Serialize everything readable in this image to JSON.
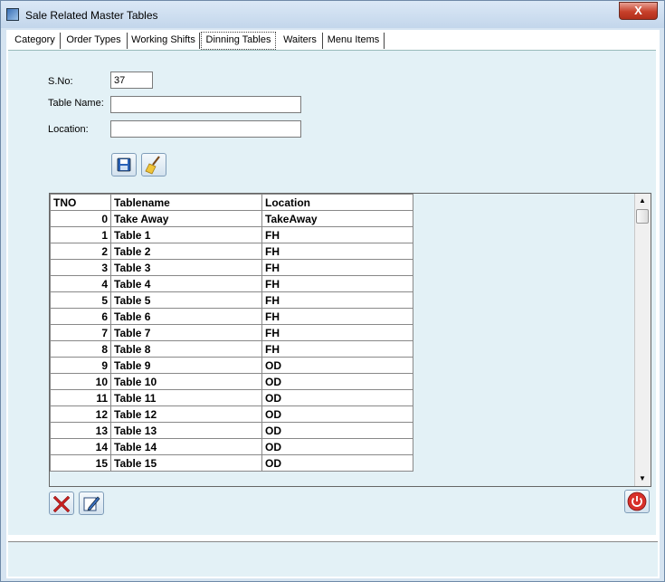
{
  "window": {
    "title": "Sale Related Master Tables",
    "close_label": "X"
  },
  "tabs": [
    {
      "label": "Category"
    },
    {
      "label": "Order Types"
    },
    {
      "label": "Working Shifts"
    },
    {
      "label": "Dinning Tables"
    },
    {
      "label": "Waiters"
    },
    {
      "label": "Menu Items"
    }
  ],
  "form": {
    "sno_label": "S.No:",
    "sno_value": "37",
    "tablename_label": "Table Name:",
    "tablename_value": "",
    "location_label": "Location:",
    "location_value": ""
  },
  "buttons": {
    "save_icon": "save-disk-icon",
    "clear_icon": "broom-icon",
    "delete_icon": "delete-x-icon",
    "edit_icon": "edit-pencil-icon",
    "exit_icon": "power-icon"
  },
  "grid": {
    "headers": [
      "TNO",
      "Tablename",
      "Location"
    ],
    "rows": [
      [
        "0",
        "Take Away",
        "TakeAway"
      ],
      [
        "1",
        "Table 1",
        "FH"
      ],
      [
        "2",
        "Table 2",
        "FH"
      ],
      [
        "3",
        "Table 3",
        "FH"
      ],
      [
        "4",
        "Table 4",
        "FH"
      ],
      [
        "5",
        "Table 5",
        "FH"
      ],
      [
        "6",
        "Table 6",
        "FH"
      ],
      [
        "7",
        "Table 7",
        "FH"
      ],
      [
        "8",
        "Table 8",
        "FH"
      ],
      [
        "9",
        "Table 9",
        "OD"
      ],
      [
        "10",
        "Table 10",
        "OD"
      ],
      [
        "11",
        "Table 11",
        "OD"
      ],
      [
        "12",
        "Table 12",
        "OD"
      ],
      [
        "13",
        "Table 13",
        "OD"
      ],
      [
        "14",
        "Table 14",
        "OD"
      ],
      [
        "15",
        "Table 15",
        "OD"
      ]
    ]
  },
  "colors": {
    "accent": "#c7402a",
    "panel": "#e3f1f6"
  }
}
